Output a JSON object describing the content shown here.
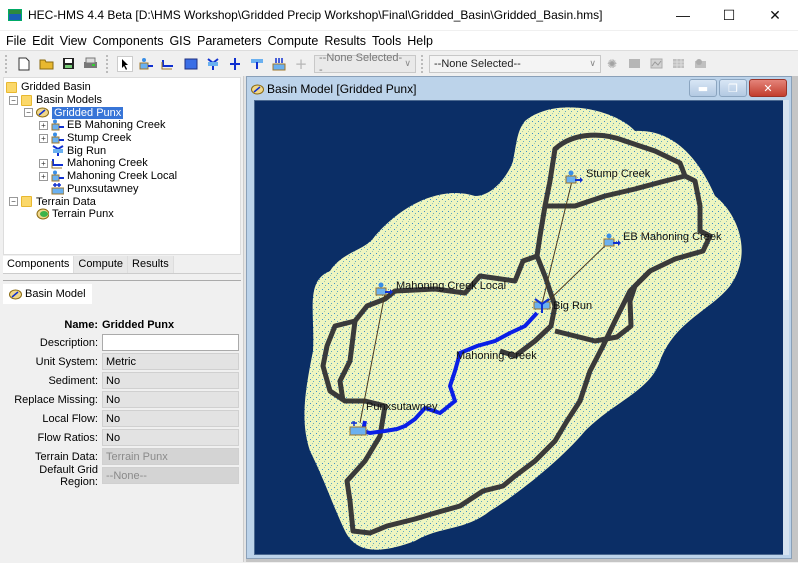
{
  "window": {
    "title": "HEC-HMS 4.4 Beta [D:\\HMS Workshop\\Gridded Precip Workshop\\Final\\Gridded_Basin\\Gridded_Basin.hms]",
    "controls": {
      "minimize": "—",
      "maximize": "☐",
      "close": "✕"
    }
  },
  "menu": [
    "File",
    "Edit",
    "View",
    "Components",
    "GIS",
    "Parameters",
    "Compute",
    "Results",
    "Tools",
    "Help"
  ],
  "toolbar": {
    "file_icons": [
      "new-file-icon",
      "open-folder-icon",
      "save-icon",
      "print-icon"
    ],
    "tool_icons": [
      "arrow-select-icon",
      "subbasin-tool-icon",
      "reach-tool-icon",
      "reservoir-tool-icon",
      "junction-tool-icon",
      "diversion-tool-icon",
      "source-tool-icon",
      "sink-tool-icon",
      "add-point-icon"
    ],
    "element_select": "--None Selected--",
    "run_select": "--None Selected--",
    "result_icons": [
      "compute-icon",
      "global-summary-icon",
      "graph-icon",
      "table-icon",
      "time-series-icon"
    ]
  },
  "tree": {
    "root": "Gridded Basin",
    "basin_models": "Basin Models",
    "basin_model_selected": "Gridded Punx",
    "elements": [
      {
        "label": "EB Mahoning Creek",
        "type": "subbasin",
        "expandable": true
      },
      {
        "label": "Stump Creek",
        "type": "subbasin",
        "expandable": true
      },
      {
        "label": "Big Run",
        "type": "junction",
        "expandable": false
      },
      {
        "label": "Mahoning Creek",
        "type": "reach",
        "expandable": true
      },
      {
        "label": "Mahoning Creek Local",
        "type": "subbasin",
        "expandable": true
      },
      {
        "label": "Punxsutawney",
        "type": "sink",
        "expandable": false
      }
    ],
    "terrain_data": "Terrain Data",
    "terrain_item": "Terrain Punx"
  },
  "left_tabs": [
    "Components",
    "Compute",
    "Results"
  ],
  "properties": {
    "tab": "Basin Model",
    "name_label": "Name:",
    "name_value": "Gridded Punx",
    "rows": [
      {
        "label": "Description:",
        "value": ""
      },
      {
        "label": "Unit System:",
        "value": "Metric"
      },
      {
        "label": "Sediment:",
        "value": "No"
      },
      {
        "label": "Replace Missing:",
        "value": "No"
      },
      {
        "label": "Local Flow:",
        "value": "No"
      },
      {
        "label": "Flow Ratios:",
        "value": "No"
      },
      {
        "label": "Terrain Data:",
        "value": "Terrain Punx"
      },
      {
        "label": "Default Grid Region:",
        "value": "--None--"
      }
    ]
  },
  "basin_window": {
    "title": "Basin Model [Gridded Punx]",
    "colors": {
      "background": "#0b2e66",
      "terrain": "#eef5c0",
      "boundary": "#3a3a3a",
      "river": "#0a1fe6"
    },
    "labels": {
      "stump_creek": "Stump Creek",
      "eb_mahoning": "EB Mahoning Creek",
      "mahoning_local": "Mahoning Creek Local",
      "big_run": "Big Run",
      "mahoning_creek": "Mahoning Creek",
      "punxsutawney": "Punxsutawney"
    }
  }
}
